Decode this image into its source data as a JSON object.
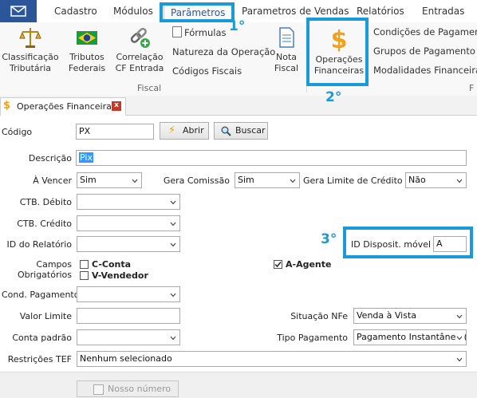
{
  "menu": {
    "items": [
      "Cadastro",
      "Módulos",
      "Parâmetros",
      "Parametros de Vendas",
      "Relatórios",
      "Entradas"
    ]
  },
  "ribbon": {
    "big_buttons": [
      {
        "label1": "Classificação",
        "label2": "Tributária",
        "icon": "scales-icon"
      },
      {
        "label1": "Tributos",
        "label2": "Federais",
        "icon": "brazil-flag-icon"
      },
      {
        "label1": "Correlação",
        "label2": "CF Entrada",
        "icon": "chain-link-add-icon"
      },
      {
        "label1": "Nota",
        "label2": "Fiscal",
        "icon": "document-icon"
      },
      {
        "label1": "Operações",
        "label2": "Financeiras",
        "icon": "dollar-icon"
      }
    ],
    "small_buttons_fiscal": [
      "Fórmulas",
      "Natureza da Operação",
      "Códigos Fiscais"
    ],
    "small_buttons_fin": [
      "Condições de Pagamento",
      "Grupos de Pagamento",
      "Modalidades Financeira"
    ],
    "group_fiscal": "Fiscal",
    "group_right_label": "F"
  },
  "tab": {
    "title": "Operações Financeiras",
    "close": "x"
  },
  "form": {
    "codigo_label": "Código",
    "codigo_value": "PX",
    "abrir_label": "Abrir",
    "buscar_label": "Buscar",
    "descricao_label": "Descrição",
    "descricao_value": "Pix",
    "a_vencer_label": "À Vencer",
    "a_vencer_value": "Sim",
    "gera_comissao_label": "Gera Comissão",
    "gera_comissao_value": "Sim",
    "gera_limite_label": "Gera Limite de Crédito",
    "gera_limite_value": "Não",
    "ctb_debito_label": "CTB. Débito",
    "ctb_debito_value": "",
    "ctb_credito_label": "CTB. Crédito",
    "ctb_credito_value": "",
    "id_relatorio_label": "ID do Relatório",
    "id_relatorio_value": "",
    "id_disposit_label": "ID Disposit. móvel",
    "id_disposit_value": "A",
    "campos_label1": "Campos",
    "campos_label2": "Obrigatórios",
    "cb_c_conta": "C-Conta",
    "cb_v_vendedor": "V-Vendedor",
    "cb_a_agente": "A-Agente",
    "cond_pagamento_label": "Cond. Pagamento",
    "cond_pagamento_value": "",
    "valor_limite_label": "Valor Limite",
    "valor_limite_value": "",
    "situacao_nfe_label": "Situação NFe",
    "situacao_nfe_value": "Venda à Vista",
    "conta_padrao_label": "Conta padrão",
    "conta_padrao_value": "",
    "tipo_pagamento_label": "Tipo Pagamento",
    "tipo_pagamento_value": "Pagamento Instantâneo (",
    "restricoes_tef_label": "Restrições TEF",
    "restricoes_tef_value": "Nenhum selecionado",
    "nosso_numero_label": "Nosso número"
  },
  "annotations": [
    "1°",
    "2°",
    "3°"
  ],
  "colors": {
    "annotation": "#1a9ad6",
    "accent": "#2b579a",
    "selection": "#3399ff"
  }
}
